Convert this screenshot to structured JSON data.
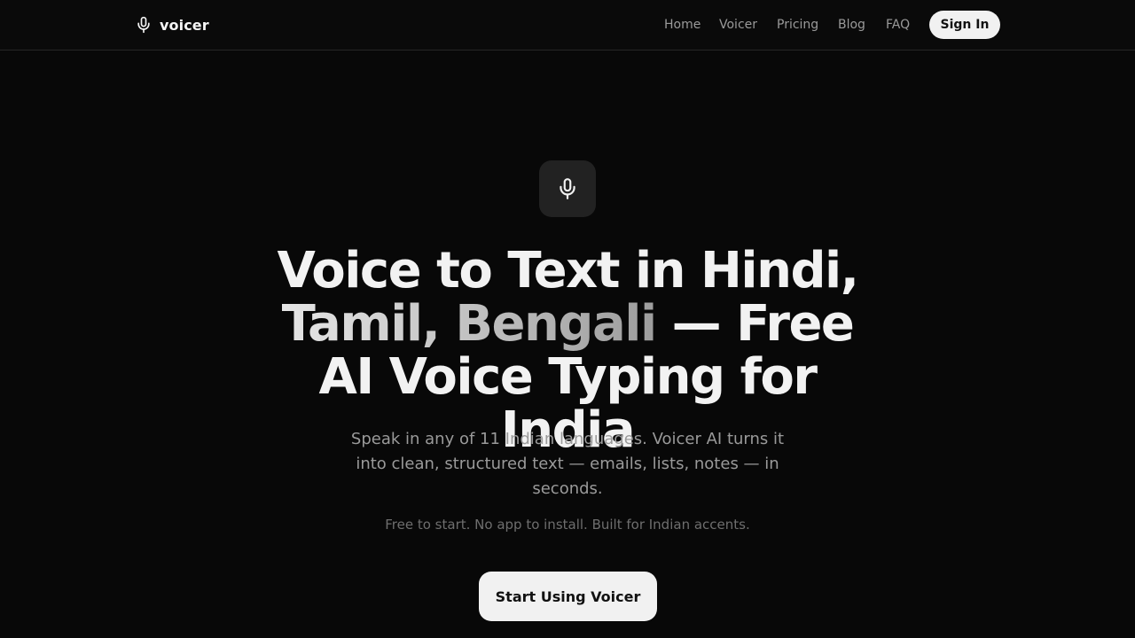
{
  "header": {
    "brand": {
      "icon": "microphone-icon",
      "name": "voicer"
    },
    "nav": [
      {
        "label": "Home"
      },
      {
        "label": "Voicer"
      },
      {
        "label": "Pricing"
      },
      {
        "label": "Blog"
      },
      {
        "label": "FAQ"
      }
    ],
    "sign_in_label": "Sign In"
  },
  "hero": {
    "icon": "microphone-icon",
    "headline": {
      "part1": "Voice to Text in Hindi,",
      "accent": "Tamil, Bengali",
      "part2": "— Free AI Voice Typing for India"
    },
    "subtitle": "Speak in any of 11 Indian languages. Voicer AI turns it into clean, structured text — emails, lists, notes — in seconds.",
    "tagline": "Free to start. No app to install. Built for Indian accents.",
    "cta_label": "Start Using Voicer"
  },
  "colors": {
    "background": "#080808",
    "text": "#f2f2f2",
    "muted": "#9a9a9a",
    "button": "#f1f1f1"
  }
}
